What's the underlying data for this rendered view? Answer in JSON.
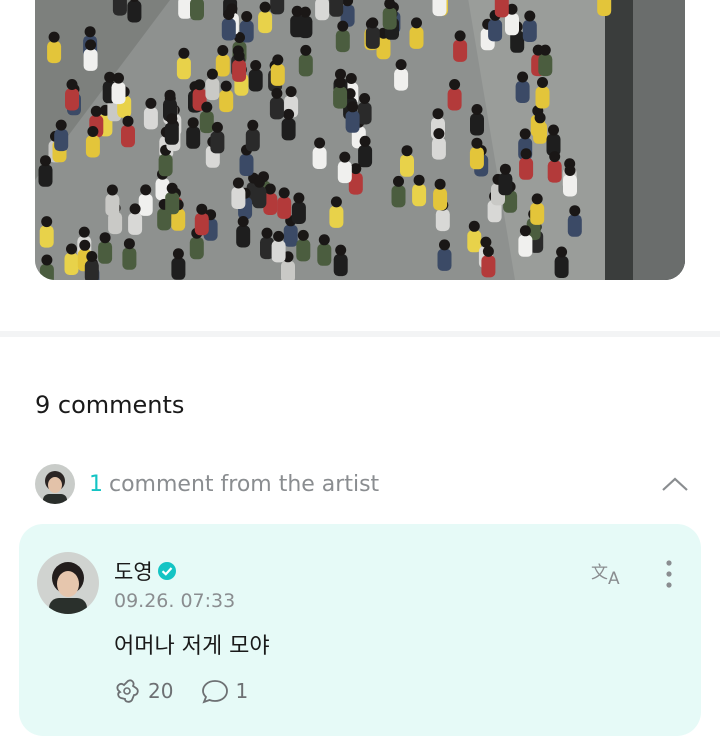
{
  "comments": {
    "count_label": "9 comments"
  },
  "artist_comments": {
    "count": "1",
    "label": "comment from the artist"
  },
  "comment": {
    "author": "도영",
    "timestamp": "09.26. 07:33",
    "text": "어머나 저게 모야",
    "reactions": "20",
    "replies": "1"
  },
  "icons": {
    "verified": "verified-check-icon",
    "translate": "translate-icon",
    "more": "more-vertical-icon",
    "reaction": "reaction-icon",
    "reply": "reply-icon",
    "collapse": "chevron-up-icon"
  },
  "colors": {
    "accent": "#14c4c4",
    "card_bg": "#e6faf7",
    "muted": "#8a8d90"
  }
}
